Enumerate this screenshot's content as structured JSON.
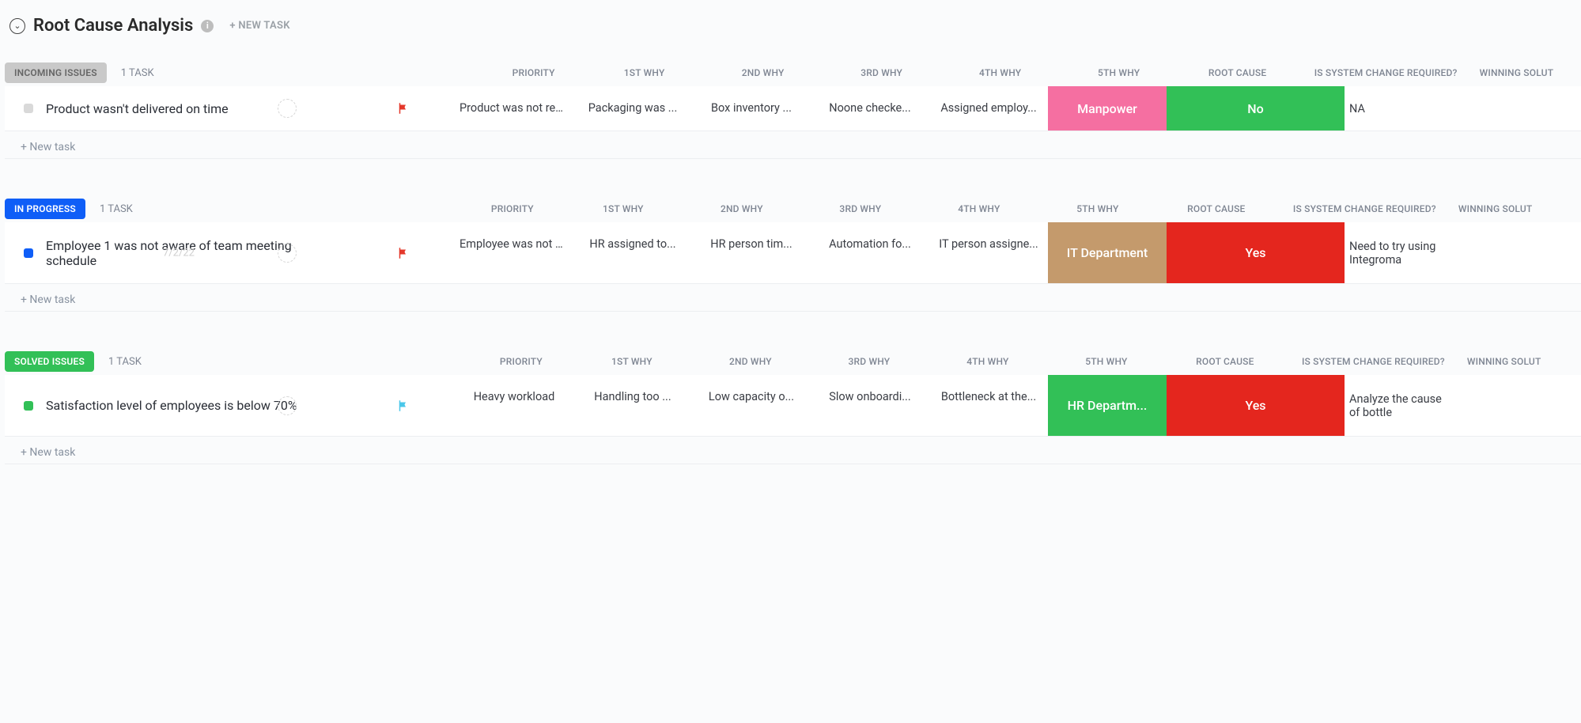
{
  "header": {
    "title": "Root Cause Analysis",
    "new_task": "+ NEW TASK",
    "info_glyph": "i",
    "chevron_glyph": "⌄"
  },
  "columns": {
    "priority": "PRIORITY",
    "why1": "1ST WHY",
    "why2": "2ND WHY",
    "why3": "3RD WHY",
    "why4": "4TH WHY",
    "why5": "5TH WHY",
    "root": "ROOT CAUSE",
    "sys": "IS SYSTEM CHANGE REQUIRED?",
    "win": "WINNING SOLUT"
  },
  "add_row": "+ New task",
  "groups": [
    {
      "status": "INCOMING ISSUES",
      "chip_class": "chip-grey",
      "sq_class": "sq-grey",
      "count": "1 TASK",
      "tasks": [
        {
          "title": "Product wasn't delivered on time",
          "date": "",
          "flag_class": "flag-red",
          "why1": "Product was not rea...",
          "why2": "Packaging was ...",
          "why3": "Box inventory ...",
          "why4": "Noone checke...",
          "why5": "Assigned employ...",
          "root": {
            "text": "Manpower",
            "class": "pill-pink"
          },
          "sys": {
            "text": "No",
            "class": "pill-green"
          },
          "win": "NA"
        }
      ]
    },
    {
      "status": "IN PROGRESS",
      "chip_class": "chip-blue",
      "sq_class": "sq-blue",
      "count": "1 TASK",
      "tasks": [
        {
          "title": "Employee 1 was not aware of team meeting schedule",
          "date": "7/2/22",
          "flag_class": "flag-red",
          "why1": "Employee was not b...",
          "why2": "HR assigned to...",
          "why3": "HR person tim...",
          "why4": "Automation fo...",
          "why5": "IT person assigne...",
          "root": {
            "text": "IT Department",
            "class": "pill-tan"
          },
          "sys": {
            "text": "Yes",
            "class": "pill-red"
          },
          "win": "Need to try using Integroma"
        }
      ]
    },
    {
      "status": "SOLVED ISSUES",
      "chip_class": "chip-green",
      "sq_class": "sq-green",
      "count": "1 TASK",
      "tasks": [
        {
          "title": "Satisfaction level of employees is below 70%",
          "date": "",
          "flag_class": "flag-cyan",
          "why1": "Heavy workload",
          "why2": "Handling too ...",
          "why3": "Low capacity o...",
          "why4": "Slow onboardi...",
          "why5": "Bottleneck at the...",
          "root": {
            "text": "HR Departm...",
            "class": "pill-green"
          },
          "sys": {
            "text": "Yes",
            "class": "pill-red"
          },
          "win": "Analyze the cause of bottle"
        }
      ]
    }
  ]
}
